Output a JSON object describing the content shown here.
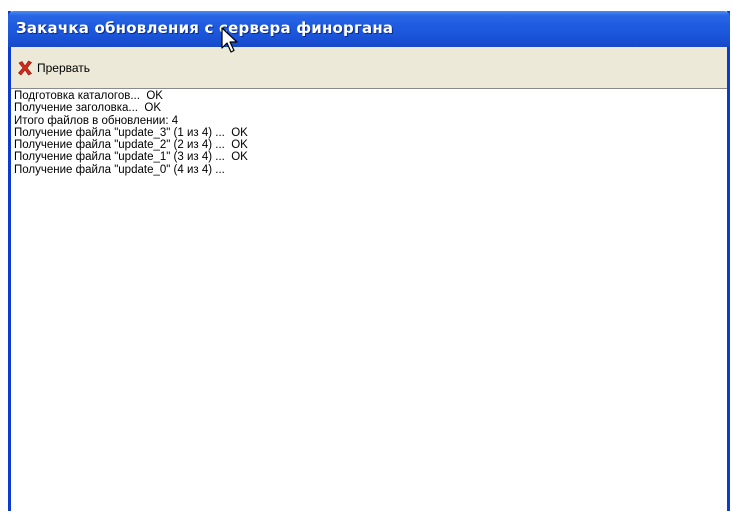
{
  "window": {
    "title": "Закачка обновления с сервера финоргана"
  },
  "toolbar": {
    "abort_label": "Прервать",
    "abort_icon": "red-x-icon"
  },
  "log": {
    "lines": [
      "Подготовка каталогов...  OK",
      "Получение заголовка...  OK",
      "Итого файлов в обновлении: 4",
      "Получение файла \"update_3\" (1 из 4) ...  OK",
      "Получение файла \"update_2\" (2 из 4) ...  OK",
      "Получение файла \"update_1\" (3 из 4) ...  OK",
      "Получение файла \"update_0\" (4 из 4) ..."
    ]
  },
  "colors": {
    "titlebar": "#1f5be0",
    "window_border": "#0b3bcf",
    "toolbar_bg": "#ece9d8",
    "abort_icon": "#d42a1a"
  }
}
